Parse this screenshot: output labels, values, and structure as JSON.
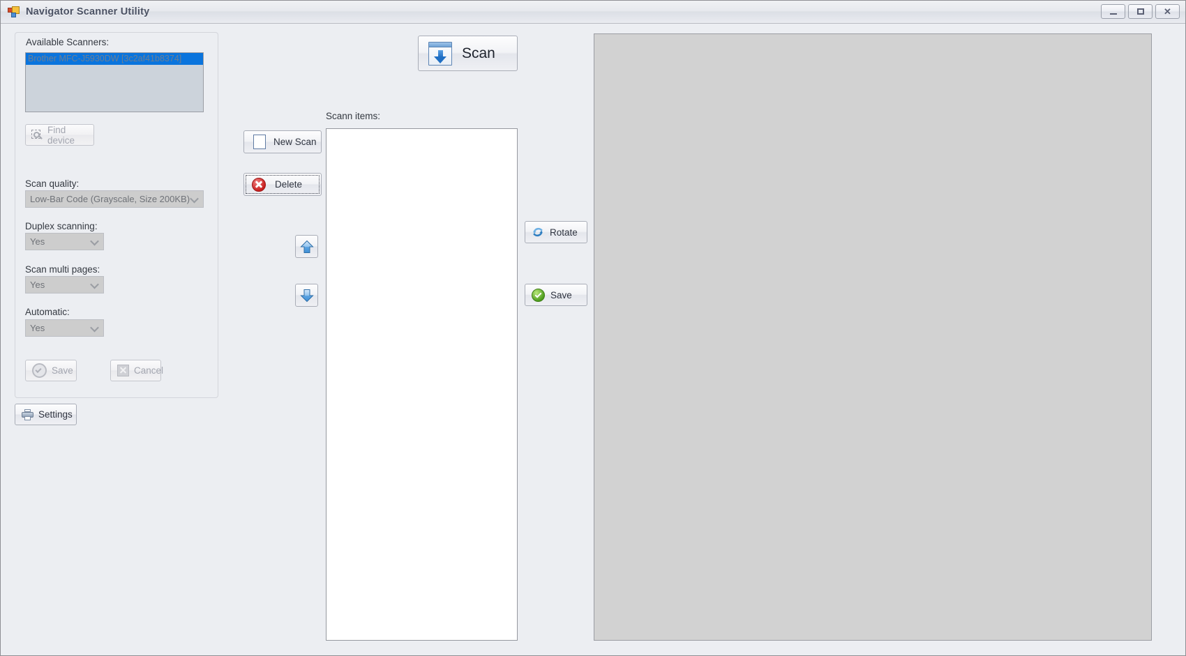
{
  "window": {
    "title": "Navigator Scanner Utility",
    "icon": "form-icon",
    "controls": {
      "minimize": "–",
      "maximize": "□",
      "close": "✕"
    }
  },
  "left_panel": {
    "available_scanners_label": "Available Scanners:",
    "scanner_list": {
      "items": [
        {
          "label": "Brother MFC-J5930DW [3c2af41b8374]",
          "selected": true
        }
      ],
      "selection_color": "#0a74dd"
    },
    "find_device_button": {
      "label": "Find device",
      "icon": "magnifier-icon",
      "enabled": false
    },
    "scan_quality": {
      "label": "Scan quality:",
      "value": "Low-Bar Code (Grayscale, Size 200KB)",
      "enabled": false
    },
    "duplex_scanning": {
      "label": "Duplex scanning:",
      "value": "Yes",
      "enabled": false
    },
    "scan_multi_pages": {
      "label": "Scan multi pages:",
      "value": "Yes",
      "enabled": false
    },
    "automatic": {
      "label": "Automatic:",
      "value": "Yes",
      "enabled": false
    },
    "save_button": {
      "label": "Save",
      "icon": "check-circle-icon",
      "enabled": false
    },
    "cancel_button": {
      "label": "Cancel",
      "icon": "x-box-icon",
      "enabled": false
    },
    "settings_button": {
      "label": "Settings",
      "icon": "printer-icon",
      "enabled": true
    }
  },
  "toolbar": {
    "scan_button": {
      "label": "Scan",
      "icon": "scan-download-icon"
    }
  },
  "center_panel": {
    "scann_items_label": "Scann items:",
    "new_scan_button": {
      "label": "New Scan",
      "icon": "blank-page-icon"
    },
    "delete_button": {
      "label": "Delete",
      "icon": "delete-red-x-icon",
      "focused": true
    },
    "move_up_button": {
      "icon": "arrow-up-icon"
    },
    "move_down_button": {
      "icon": "arrow-down-icon"
    },
    "scan_items_list": {
      "items": [],
      "background": "#ffffff"
    },
    "rotate_button": {
      "label": "Rotate",
      "icon": "rotate-icon"
    },
    "save_image_button": {
      "label": "Save",
      "icon": "check-circle-green-icon"
    }
  },
  "preview_panel": {
    "background": "#d2d2d2",
    "content": ""
  }
}
